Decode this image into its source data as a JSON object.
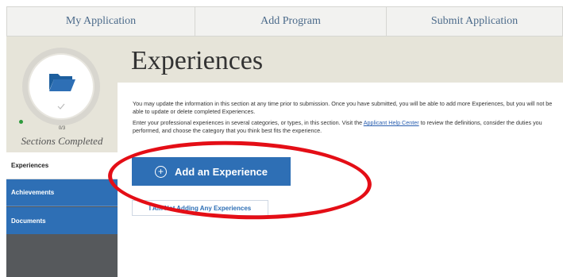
{
  "topnav": {
    "tabs": [
      {
        "label": "My Application"
      },
      {
        "label": "Add Program"
      },
      {
        "label": "Submit Application"
      }
    ]
  },
  "sidebar": {
    "progress": {
      "count": "0/3",
      "label": "Sections Completed"
    },
    "items": [
      {
        "label": "Experiences"
      },
      {
        "label": "Achievements"
      },
      {
        "label": "Documents"
      }
    ]
  },
  "main": {
    "title": "Experiences",
    "para1": "You may update the information in this section at any time prior to submission. Once you have submitted, you will be able to add more Experiences, but you will not be able to update or delete completed Experiences.",
    "para2_pre": "Enter your professional experiences in several categories, or types, in this section. Visit the ",
    "para2_link": "Applicant Help Center",
    "para2_post": " to review the definitions, consider the duties you performed, and choose the category that you think best fits the experience.",
    "add_button": "Add an Experience",
    "not_adding_button": "I Am Not Adding Any Experiences"
  },
  "colors": {
    "primary": "#2e6fb5",
    "highlight": "#e40e16",
    "header_bg": "#e6e4d9",
    "sidebar_dark": "#56595c"
  }
}
